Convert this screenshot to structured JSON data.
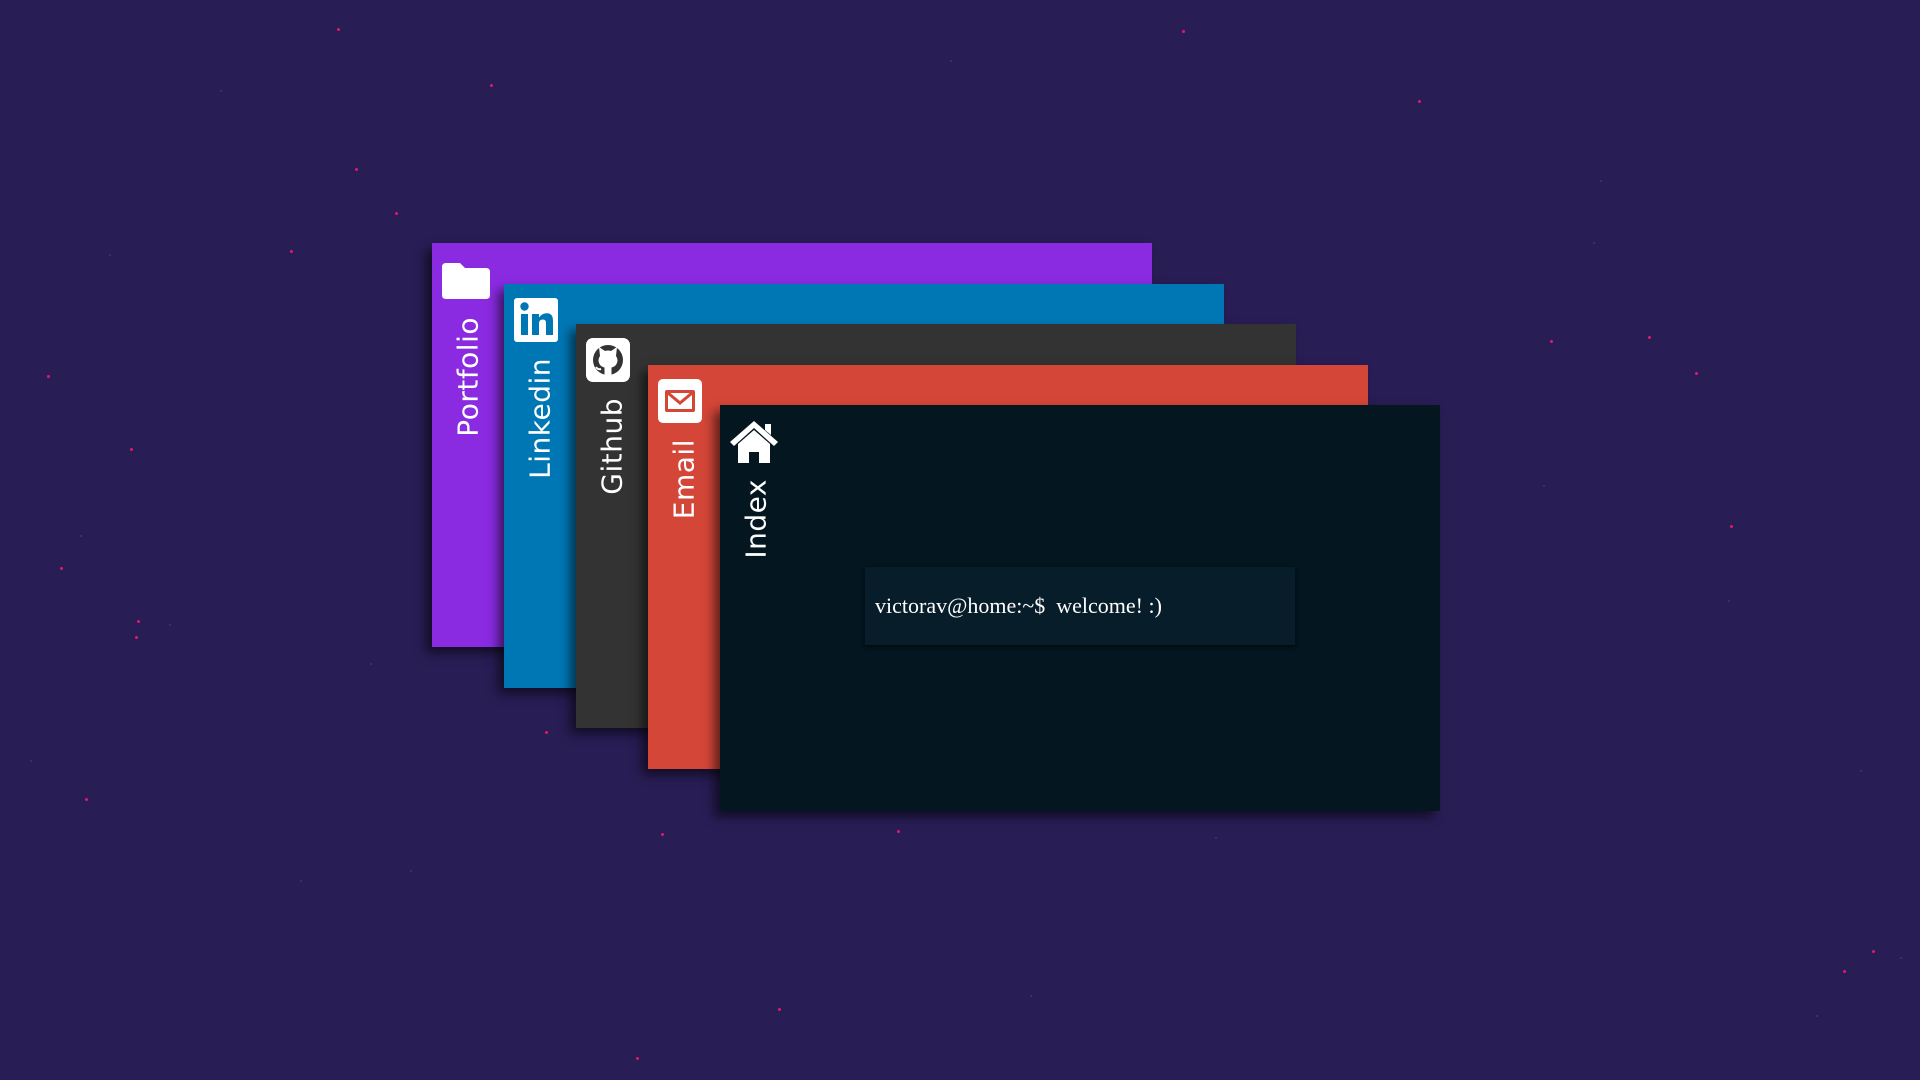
{
  "colors": {
    "background": "#291d55",
    "star": "#e0196e",
    "portfolio": "#8a2be2",
    "linkedin": "#0077b5",
    "github": "#333333",
    "email": "#d44638",
    "index": "#04161f",
    "terminal": "#071d2a"
  },
  "cards": [
    {
      "id": "portfolio",
      "label": "Portfolio",
      "icon": "folder-icon"
    },
    {
      "id": "linkedin",
      "label": "Linkedin",
      "icon": "linkedin-icon"
    },
    {
      "id": "github",
      "label": "Github",
      "icon": "github-icon"
    },
    {
      "id": "email",
      "label": "Email",
      "icon": "envelope-icon"
    },
    {
      "id": "index",
      "label": "Index",
      "icon": "home-icon"
    }
  ],
  "terminal": {
    "prompt": "victorav@home:~$",
    "message": "welcome! :)"
  }
}
